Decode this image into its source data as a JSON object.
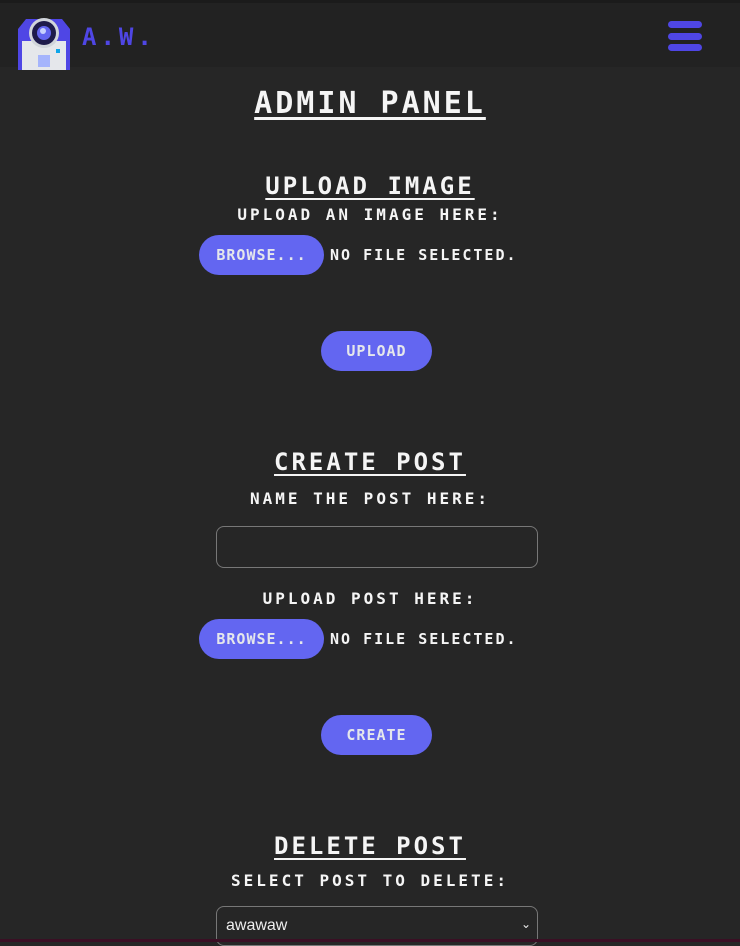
{
  "header": {
    "brand": "A.W."
  },
  "page_title": "ADMIN PANEL",
  "upload_image": {
    "title": "UPLOAD IMAGE",
    "label": "UPLOAD AN IMAGE HERE:",
    "browse": "BROWSE...",
    "file_status": "NO FILE SELECTED.",
    "submit": "UPLOAD"
  },
  "create_post": {
    "title": "CREATE POST",
    "name_label": "NAME THE POST HERE:",
    "name_value": "",
    "upload_label": "UPLOAD POST HERE:",
    "browse": "BROWSE...",
    "file_status": "NO FILE SELECTED.",
    "submit": "CREATE"
  },
  "delete_post": {
    "title": "DELETE POST",
    "label": "SELECT POST TO DELETE:",
    "selected": "awawaw"
  },
  "colors": {
    "accent": "#6366f1",
    "brand": "#4f46e5",
    "background": "#262626"
  }
}
